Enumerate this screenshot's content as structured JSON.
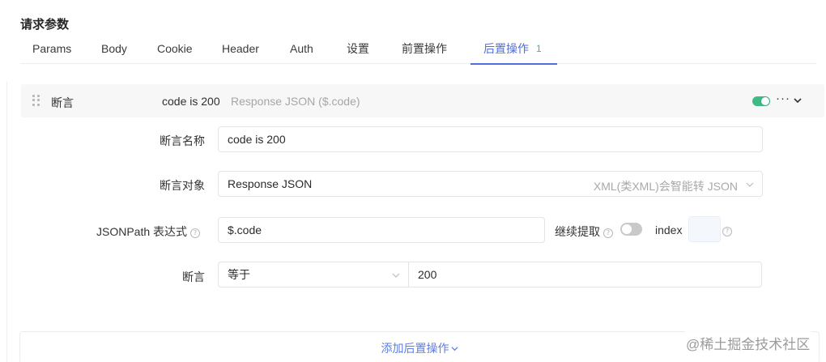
{
  "section": {
    "title": "请求参数"
  },
  "tabs": [
    {
      "label": "Params"
    },
    {
      "label": "Body"
    },
    {
      "label": "Cookie"
    },
    {
      "label": "Header"
    },
    {
      "label": "Auth"
    },
    {
      "label": "设置"
    },
    {
      "label": "前置操作"
    },
    {
      "label": "后置操作",
      "count": "1",
      "active": true
    }
  ],
  "assertion": {
    "header_label": "断言",
    "summary": "code is 200",
    "summary_sub": "Response JSON ($.code)",
    "enabled": true,
    "more_icon": "ellipsis-icon",
    "collapse_icon": "chevron-down-icon",
    "name_label": "断言名称",
    "name_value": "code is 200",
    "target_label": "断言对象",
    "target_value": "Response JSON",
    "target_hint": "XML(类XML)会智能转 JSON",
    "jsonpath_label": "JSONPath 表达式",
    "jsonpath_value": "$.code",
    "continue_extract_label": "继续提取",
    "continue_extract_on": false,
    "index_label": "index",
    "index_value": "",
    "assert_label": "断言",
    "operator_value": "等于",
    "expected_value": "200"
  },
  "add_post_action": {
    "label": "添加后置操作"
  },
  "watermark": "@稀土掘金技术社区",
  "colors": {
    "accent": "#4f6fdc",
    "success": "#3dbb86",
    "link": "#5d7ee6"
  }
}
